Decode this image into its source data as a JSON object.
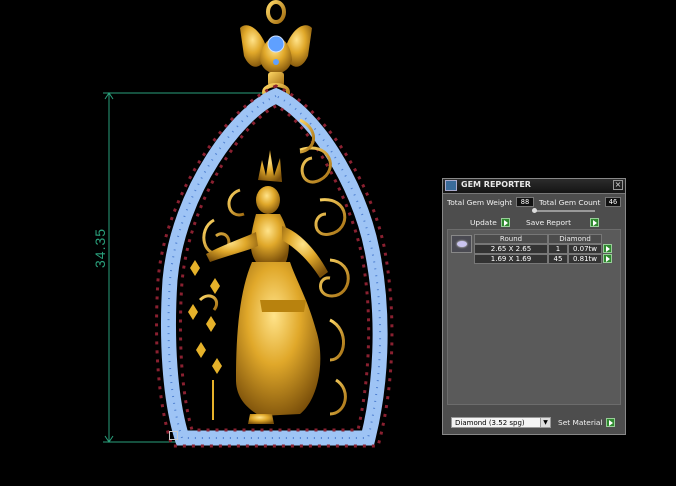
{
  "dimension_label": "34.35",
  "gem_reporter": {
    "title": "GEM REPORTER",
    "close_symbol": "×",
    "total_gem_weight_label": "Total Gem Weight",
    "total_gem_weight_value": "88",
    "total_gem_count_label": "Total Gem Count",
    "total_gem_count_value": "46",
    "update_label": "Update",
    "save_report_label": "Save Report",
    "table": {
      "headers": [
        "Round",
        "Diamond"
      ],
      "rows": [
        {
          "size": "2.65 X 2.65",
          "count": "1",
          "weight": "0.07tw"
        },
        {
          "size": "1.69 X 1.69",
          "count": "45",
          "weight": "0.81tw"
        }
      ]
    },
    "material_select": "Diamond    (3.52 spg)",
    "set_material_label": "Set Material"
  },
  "colors": {
    "dimension_line": "#2aa07c",
    "gold": "#d9a51e",
    "blue_stone": "#7fb0f0",
    "ruby_stone": "#8a2030",
    "panel_bg": "#4d4d4d",
    "green_button": "#2f8a2f"
  }
}
